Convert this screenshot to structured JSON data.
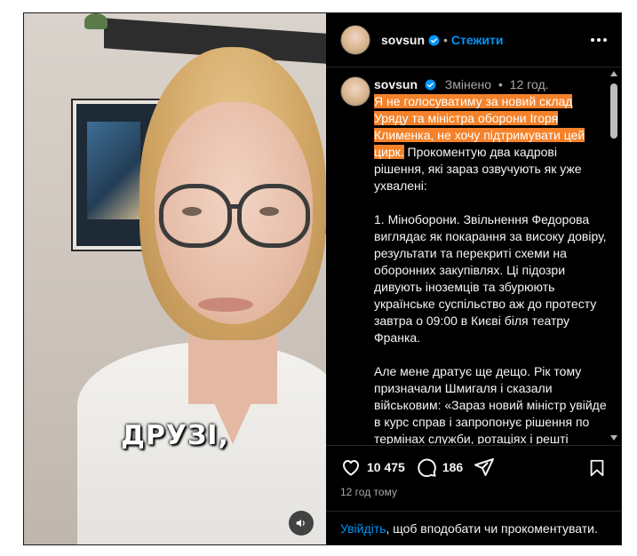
{
  "media": {
    "caption": "ДРУЗІ,",
    "sound_icon": "speaker-icon"
  },
  "header": {
    "username": "sovsun",
    "verified_icon": "verified-badge-icon",
    "separator": "•",
    "follow_label": "Стежити",
    "more_icon": "more-options-icon"
  },
  "post": {
    "username": "sovsun",
    "edited_label": "Змінено",
    "separator": "•",
    "time": "12 год.",
    "highlighted_text": "Я не голосуватиму за новий склад Уряду та міністра оборони Ігоря Клименка, не хочу підтримувати цей цирк.",
    "intro_rest": " Прокоментую два кадрові рішення, які зараз озвучують як уже ухвалені:",
    "paragraph_2": "1. Міноборони. Звільнення Федорова виглядає як покарання за високу довіру, результати та перекриті схеми на оборонних закупівлях. Ці підозри дивують іноземців та збурюють українське суспільство аж до протесту завтра о 09:00 в Києві біля театру Франка.",
    "paragraph_3": "Але мене дратує ще дещо. Рік тому призначали Шмигаля і сказали військовим: «Зараз новий міністр увійде в курс справ і запропонує рішення по термінах служби, ротаціях і решті питань». За пів року Шмигаля"
  },
  "actions": {
    "likes": "10 475",
    "comments": "186",
    "like_icon": "heart-icon",
    "comment_icon": "comment-icon",
    "share_icon": "share-icon",
    "save_icon": "bookmark-icon"
  },
  "meta": {
    "posted_ago": "12 год тому"
  },
  "login_prompt": {
    "link_label": "Увійдіть",
    "rest": ", щоб вподобати чи прокоментувати."
  },
  "colors": {
    "accent": "#0095f6",
    "highlight": "#f5822a",
    "background": "#000000"
  }
}
